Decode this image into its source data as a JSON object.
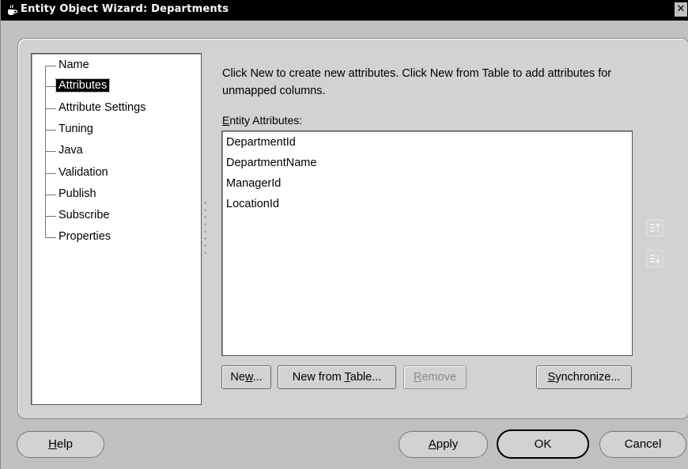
{
  "window": {
    "title": "Entity Object Wizard: Departments",
    "close_label": "✕",
    "icon": "coffee-cup-icon"
  },
  "nav": {
    "items": [
      {
        "label": "Name"
      },
      {
        "label": "Attributes",
        "selected": true
      },
      {
        "label": "Attribute Settings"
      },
      {
        "label": "Tuning"
      },
      {
        "label": "Java"
      },
      {
        "label": "Validation"
      },
      {
        "label": "Publish"
      },
      {
        "label": "Subscribe"
      },
      {
        "label": "Properties"
      }
    ]
  },
  "content": {
    "description": "Click New to create new attributes.  Click New from Table to add attributes for unmapped columns.",
    "attributes_label_mnemonic": "E",
    "attributes_label_rest": "ntity Attributes:",
    "attributes": [
      "DepartmentId",
      "DepartmentName",
      "ManagerId",
      "LocationId"
    ],
    "move_up_icon": "move-up-icon",
    "move_down_icon": "move-down-icon"
  },
  "buttons": {
    "new_pre": "Ne",
    "new_mn": "w",
    "new_post": "...",
    "new_from_table_pre": "New from ",
    "new_from_table_mn": "T",
    "new_from_table_post": "able...",
    "remove_mn": "R",
    "remove_post": "emove",
    "synchronize_mn": "S",
    "synchronize_post": "ynchronize..."
  },
  "footer": {
    "help_mn": "H",
    "help_post": "elp",
    "apply_mn": "A",
    "apply_post": "pply",
    "ok_label": "OK",
    "cancel_label": "Cancel"
  },
  "colors": {
    "titlebar": "#000000",
    "dialog_bg": "#c0c0c0",
    "panel_bg": "#d2d2d2",
    "selection": "#000000"
  }
}
